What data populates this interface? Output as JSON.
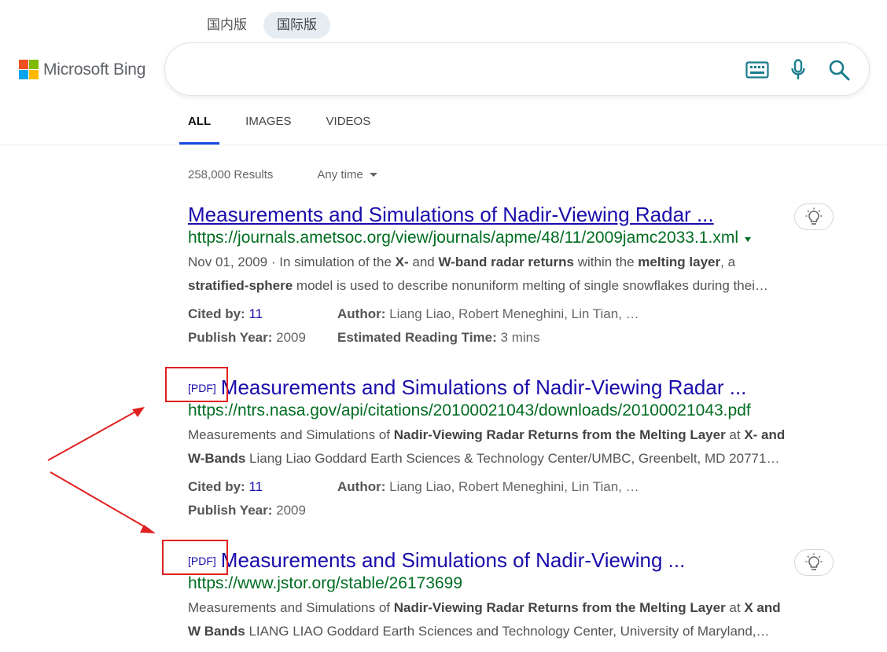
{
  "region_tabs": [
    {
      "label": "国内版",
      "active": false
    },
    {
      "label": "国际版",
      "active": true
    }
  ],
  "logo": {
    "text": "Microsoft Bing",
    "colors": [
      "#f25022",
      "#7fba00",
      "#00a4ef",
      "#ffb900"
    ]
  },
  "search": {
    "value": "",
    "placeholder": ""
  },
  "search_icons": [
    "keyboard-icon",
    "microphone-icon",
    "search-icon"
  ],
  "nav": [
    {
      "label": "ALL",
      "active": true
    },
    {
      "label": "IMAGES",
      "active": false
    },
    {
      "label": "VIDEOS",
      "active": false
    }
  ],
  "results_meta": {
    "count": "258,000 Results",
    "time_filter": "Any time"
  },
  "results": [
    {
      "pdf_tag": "",
      "title": "Measurements and Simulations of Nadir-Viewing Radar ...",
      "url": "https://journals.ametsoc.org/view/journals/apme/48/11/2009jamc2033.1.xml",
      "snippet_line1_parts": [
        {
          "t": "Nov 01, 2009 · In simulation of the ",
          "b": false
        },
        {
          "t": "X-",
          "b": true
        },
        {
          "t": " and ",
          "b": false
        },
        {
          "t": "W-band radar returns",
          "b": true
        },
        {
          "t": " within the ",
          "b": false
        },
        {
          "t": "melting layer",
          "b": true
        },
        {
          "t": ", a",
          "b": false
        }
      ],
      "snippet_line2_parts": [
        {
          "t": "stratified-sphere",
          "b": true
        },
        {
          "t": " model is used to describe nonuniform melting of single snowflakes during thei…",
          "b": false
        }
      ],
      "facts": {
        "cited_label": "Cited by:",
        "cited_value": "11",
        "author_label": "Author:",
        "author_value": "Liang Liao, Robert Meneghini, Lin Tian, …",
        "year_label": "Publish Year:",
        "year_value": "2009",
        "reading_label": "Estimated Reading Time:",
        "reading_value": "3 mins"
      }
    },
    {
      "pdf_tag": "[PDF]",
      "title": "Measurements and Simulations of Nadir-Viewing Radar ...",
      "url": "https://ntrs.nasa.gov/api/citations/20100021043/downloads/20100021043.pdf",
      "snippet_line1_parts": [
        {
          "t": "Measurements and Simulations of ",
          "b": false
        },
        {
          "t": "Nadir-Viewing Radar Returns from the Melting Layer",
          "b": true
        },
        {
          "t": " at ",
          "b": false
        },
        {
          "t": "X- and",
          "b": true
        }
      ],
      "snippet_line2_parts": [
        {
          "t": "W-Bands",
          "b": true
        },
        {
          "t": " Liang Liao Goddard Earth Sciences & Technology Center/UMBC, Greenbelt, MD 20771…",
          "b": false
        }
      ],
      "facts": {
        "cited_label": "Cited by:",
        "cited_value": "11",
        "author_label": "Author:",
        "author_value": "Liang Liao, Robert Meneghini, Lin Tian, …",
        "year_label": "Publish Year:",
        "year_value": "2009"
      }
    },
    {
      "pdf_tag": "[PDF]",
      "title": "Measurements and Simulations of Nadir-Viewing ...",
      "url": "https://www.jstor.org/stable/26173699",
      "snippet_line1_parts": [
        {
          "t": "Measurements and Simulations of ",
          "b": false
        },
        {
          "t": "Nadir-Viewing Radar Returns from the Melting Layer",
          "b": true
        },
        {
          "t": " at ",
          "b": false
        },
        {
          "t": "X and",
          "b": true
        }
      ],
      "snippet_line2_parts": [
        {
          "t": "W Bands",
          "b": true
        },
        {
          "t": " LIANG LIAO Goddard Earth Sciences and Technology Center, University of Maryland,…",
          "b": false
        }
      ]
    }
  ],
  "annotation_color": "#e02020"
}
